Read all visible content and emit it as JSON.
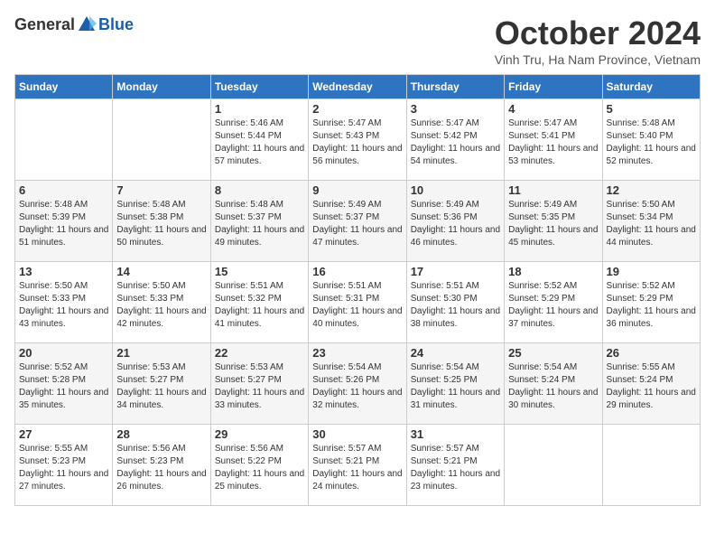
{
  "header": {
    "logo": {
      "general": "General",
      "blue": "Blue"
    },
    "title": "October 2024",
    "location": "Vinh Tru, Ha Nam Province, Vietnam"
  },
  "calendar": {
    "days_of_week": [
      "Sunday",
      "Monday",
      "Tuesday",
      "Wednesday",
      "Thursday",
      "Friday",
      "Saturday"
    ],
    "weeks": [
      [
        {
          "day": "",
          "info": ""
        },
        {
          "day": "",
          "info": ""
        },
        {
          "day": "1",
          "info": "Sunrise: 5:46 AM\nSunset: 5:44 PM\nDaylight: 11 hours and 57 minutes."
        },
        {
          "day": "2",
          "info": "Sunrise: 5:47 AM\nSunset: 5:43 PM\nDaylight: 11 hours and 56 minutes."
        },
        {
          "day": "3",
          "info": "Sunrise: 5:47 AM\nSunset: 5:42 PM\nDaylight: 11 hours and 54 minutes."
        },
        {
          "day": "4",
          "info": "Sunrise: 5:47 AM\nSunset: 5:41 PM\nDaylight: 11 hours and 53 minutes."
        },
        {
          "day": "5",
          "info": "Sunrise: 5:48 AM\nSunset: 5:40 PM\nDaylight: 11 hours and 52 minutes."
        }
      ],
      [
        {
          "day": "6",
          "info": "Sunrise: 5:48 AM\nSunset: 5:39 PM\nDaylight: 11 hours and 51 minutes."
        },
        {
          "day": "7",
          "info": "Sunrise: 5:48 AM\nSunset: 5:38 PM\nDaylight: 11 hours and 50 minutes."
        },
        {
          "day": "8",
          "info": "Sunrise: 5:48 AM\nSunset: 5:37 PM\nDaylight: 11 hours and 49 minutes."
        },
        {
          "day": "9",
          "info": "Sunrise: 5:49 AM\nSunset: 5:37 PM\nDaylight: 11 hours and 47 minutes."
        },
        {
          "day": "10",
          "info": "Sunrise: 5:49 AM\nSunset: 5:36 PM\nDaylight: 11 hours and 46 minutes."
        },
        {
          "day": "11",
          "info": "Sunrise: 5:49 AM\nSunset: 5:35 PM\nDaylight: 11 hours and 45 minutes."
        },
        {
          "day": "12",
          "info": "Sunrise: 5:50 AM\nSunset: 5:34 PM\nDaylight: 11 hours and 44 minutes."
        }
      ],
      [
        {
          "day": "13",
          "info": "Sunrise: 5:50 AM\nSunset: 5:33 PM\nDaylight: 11 hours and 43 minutes."
        },
        {
          "day": "14",
          "info": "Sunrise: 5:50 AM\nSunset: 5:33 PM\nDaylight: 11 hours and 42 minutes."
        },
        {
          "day": "15",
          "info": "Sunrise: 5:51 AM\nSunset: 5:32 PM\nDaylight: 11 hours and 41 minutes."
        },
        {
          "day": "16",
          "info": "Sunrise: 5:51 AM\nSunset: 5:31 PM\nDaylight: 11 hours and 40 minutes."
        },
        {
          "day": "17",
          "info": "Sunrise: 5:51 AM\nSunset: 5:30 PM\nDaylight: 11 hours and 38 minutes."
        },
        {
          "day": "18",
          "info": "Sunrise: 5:52 AM\nSunset: 5:29 PM\nDaylight: 11 hours and 37 minutes."
        },
        {
          "day": "19",
          "info": "Sunrise: 5:52 AM\nSunset: 5:29 PM\nDaylight: 11 hours and 36 minutes."
        }
      ],
      [
        {
          "day": "20",
          "info": "Sunrise: 5:52 AM\nSunset: 5:28 PM\nDaylight: 11 hours and 35 minutes."
        },
        {
          "day": "21",
          "info": "Sunrise: 5:53 AM\nSunset: 5:27 PM\nDaylight: 11 hours and 34 minutes."
        },
        {
          "day": "22",
          "info": "Sunrise: 5:53 AM\nSunset: 5:27 PM\nDaylight: 11 hours and 33 minutes."
        },
        {
          "day": "23",
          "info": "Sunrise: 5:54 AM\nSunset: 5:26 PM\nDaylight: 11 hours and 32 minutes."
        },
        {
          "day": "24",
          "info": "Sunrise: 5:54 AM\nSunset: 5:25 PM\nDaylight: 11 hours and 31 minutes."
        },
        {
          "day": "25",
          "info": "Sunrise: 5:54 AM\nSunset: 5:24 PM\nDaylight: 11 hours and 30 minutes."
        },
        {
          "day": "26",
          "info": "Sunrise: 5:55 AM\nSunset: 5:24 PM\nDaylight: 11 hours and 29 minutes."
        }
      ],
      [
        {
          "day": "27",
          "info": "Sunrise: 5:55 AM\nSunset: 5:23 PM\nDaylight: 11 hours and 27 minutes."
        },
        {
          "day": "28",
          "info": "Sunrise: 5:56 AM\nSunset: 5:23 PM\nDaylight: 11 hours and 26 minutes."
        },
        {
          "day": "29",
          "info": "Sunrise: 5:56 AM\nSunset: 5:22 PM\nDaylight: 11 hours and 25 minutes."
        },
        {
          "day": "30",
          "info": "Sunrise: 5:57 AM\nSunset: 5:21 PM\nDaylight: 11 hours and 24 minutes."
        },
        {
          "day": "31",
          "info": "Sunrise: 5:57 AM\nSunset: 5:21 PM\nDaylight: 11 hours and 23 minutes."
        },
        {
          "day": "",
          "info": ""
        },
        {
          "day": "",
          "info": ""
        }
      ]
    ]
  }
}
